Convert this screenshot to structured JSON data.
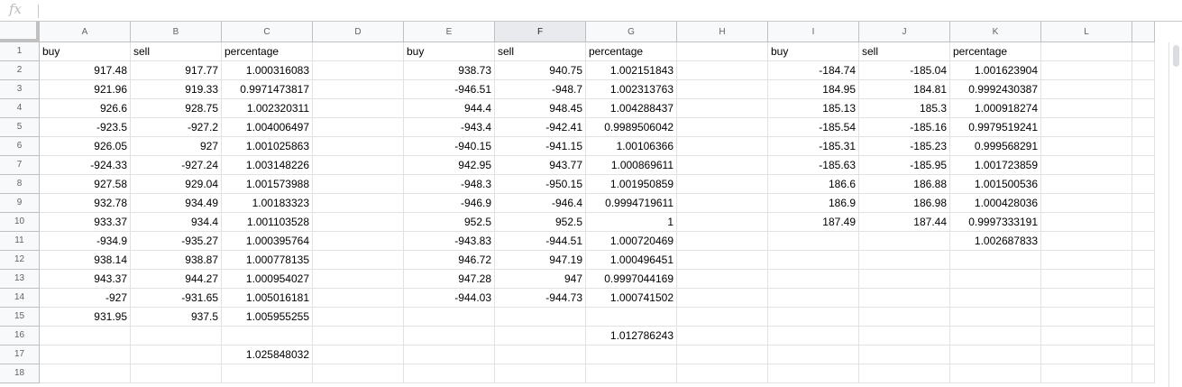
{
  "formula_bar": {
    "fx_label": "fx",
    "value": ""
  },
  "columns": [
    {
      "label": "A",
      "width": 101
    },
    {
      "label": "B",
      "width": 101
    },
    {
      "label": "C",
      "width": 101
    },
    {
      "label": "D",
      "width": 101
    },
    {
      "label": "E",
      "width": 101
    },
    {
      "label": "F",
      "width": 101,
      "selected": true
    },
    {
      "label": "G",
      "width": 101
    },
    {
      "label": "H",
      "width": 101
    },
    {
      "label": "I",
      "width": 101
    },
    {
      "label": "J",
      "width": 101
    },
    {
      "label": "K",
      "width": 101
    },
    {
      "label": "L",
      "width": 101
    },
    {
      "label": "",
      "width": 25
    }
  ],
  "rows": [
    {
      "num": "1",
      "cells": [
        "buy",
        "sell",
        "percentage",
        "",
        "buy",
        "sell",
        "percentage",
        "",
        "buy",
        "sell",
        "percentage",
        "",
        ""
      ]
    },
    {
      "num": "2",
      "cells": [
        "917.48",
        "917.77",
        "1.000316083",
        "",
        "938.73",
        "940.75",
        "1.002151843",
        "",
        "-184.74",
        "-185.04",
        "1.001623904",
        "",
        ""
      ]
    },
    {
      "num": "3",
      "cells": [
        "921.96",
        "919.33",
        "0.9971473817",
        "",
        "-946.51",
        "-948.7",
        "1.002313763",
        "",
        "184.95",
        "184.81",
        "0.9992430387",
        "",
        ""
      ]
    },
    {
      "num": "4",
      "cells": [
        "926.6",
        "928.75",
        "1.002320311",
        "",
        "944.4",
        "948.45",
        "1.004288437",
        "",
        "185.13",
        "185.3",
        "1.000918274",
        "",
        ""
      ]
    },
    {
      "num": "5",
      "cells": [
        "-923.5",
        "-927.2",
        "1.004006497",
        "",
        "-943.4",
        "-942.41",
        "0.9989506042",
        "",
        "-185.54",
        "-185.16",
        "0.9979519241",
        "",
        ""
      ]
    },
    {
      "num": "6",
      "cells": [
        "926.05",
        "927",
        "1.001025863",
        "",
        "-940.15",
        "-941.15",
        "1.00106366",
        "",
        "-185.31",
        "-185.23",
        "0.999568291",
        "",
        ""
      ]
    },
    {
      "num": "7",
      "cells": [
        "-924.33",
        "-927.24",
        "1.003148226",
        "",
        "942.95",
        "943.77",
        "1.000869611",
        "",
        "-185.63",
        "-185.95",
        "1.001723859",
        "",
        ""
      ]
    },
    {
      "num": "8",
      "cells": [
        "927.58",
        "929.04",
        "1.001573988",
        "",
        "-948.3",
        "-950.15",
        "1.001950859",
        "",
        "186.6",
        "186.88",
        "1.001500536",
        "",
        ""
      ]
    },
    {
      "num": "9",
      "cells": [
        "932.78",
        "934.49",
        "1.00183323",
        "",
        "-946.9",
        "-946.4",
        "0.9994719611",
        "",
        "186.9",
        "186.98",
        "1.000428036",
        "",
        ""
      ]
    },
    {
      "num": "10",
      "cells": [
        "933.37",
        "934.4",
        "1.001103528",
        "",
        "952.5",
        "952.5",
        "1",
        "",
        "187.49",
        "187.44",
        "0.9997333191",
        "",
        ""
      ]
    },
    {
      "num": "11",
      "cells": [
        "-934.9",
        "-935.27",
        "1.000395764",
        "",
        "-943.83",
        "-944.51",
        "1.000720469",
        "",
        "",
        "",
        "1.002687833",
        "",
        ""
      ]
    },
    {
      "num": "12",
      "cells": [
        "938.14",
        "938.87",
        "1.000778135",
        "",
        "946.72",
        "947.19",
        "1.000496451",
        "",
        "",
        "",
        "",
        "",
        ""
      ]
    },
    {
      "num": "13",
      "cells": [
        "943.37",
        "944.27",
        "1.000954027",
        "",
        "947.28",
        "947",
        "0.9997044169",
        "",
        "",
        "",
        "",
        "",
        ""
      ]
    },
    {
      "num": "14",
      "cells": [
        "-927",
        "-931.65",
        "1.005016181",
        "",
        "-944.03",
        "-944.73",
        "1.000741502",
        "",
        "",
        "",
        "",
        "",
        ""
      ]
    },
    {
      "num": "15",
      "cells": [
        "931.95",
        "937.5",
        "1.005955255",
        "",
        "",
        "",
        "",
        "",
        "",
        "",
        "",
        "",
        ""
      ]
    },
    {
      "num": "16",
      "cells": [
        "",
        "",
        "",
        "",
        "",
        "",
        "1.012786243",
        "",
        "",
        "",
        "",
        "",
        ""
      ]
    },
    {
      "num": "17",
      "cells": [
        "",
        "",
        "1.025848032",
        "",
        "",
        "",
        "",
        "",
        "",
        "",
        "",
        "",
        ""
      ]
    },
    {
      "num": "18",
      "cells": [
        "",
        "",
        "",
        "",
        "",
        "",
        "",
        "",
        "",
        "",
        "",
        "",
        ""
      ]
    }
  ]
}
